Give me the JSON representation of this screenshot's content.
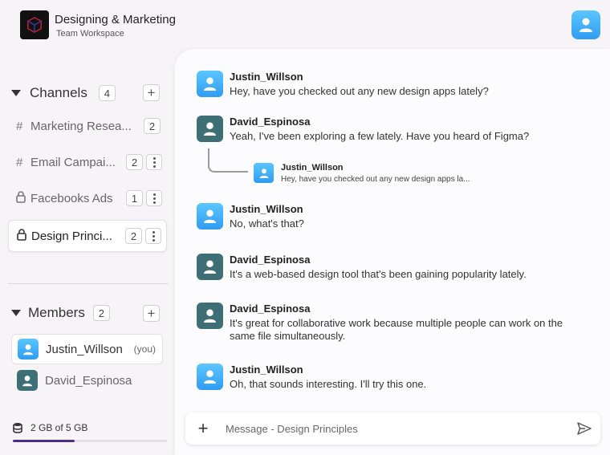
{
  "workspace": {
    "title": "Designing & Marketing",
    "subtitle": "Team Workspace"
  },
  "sidebar": {
    "channels_title": "Channels",
    "channels_count": "4",
    "channels": [
      {
        "prefix": "#",
        "label": "Marketing Resea...",
        "count": "2",
        "locked": false,
        "active": false
      },
      {
        "prefix": "#",
        "label": "Email Campai...",
        "count": "2",
        "locked": false,
        "active": false
      },
      {
        "prefix": "lock",
        "label": "Facebooks Ads",
        "count": "1",
        "locked": true,
        "active": false
      },
      {
        "prefix": "lock",
        "label": "Design Princi...",
        "count": "2",
        "locked": true,
        "active": true
      }
    ],
    "members_title": "Members",
    "members_count": "2",
    "members": [
      {
        "name": "Justin_Willson",
        "suffix": "(you)",
        "avatar": "blue",
        "active": true
      },
      {
        "name": "David_Espinosa",
        "suffix": "",
        "avatar": "teal",
        "active": false
      }
    ],
    "storage": {
      "label": "2 GB of 5 GB",
      "used_fraction": 0.4
    }
  },
  "chat": {
    "messages": [
      {
        "author": "Justin_Willson",
        "text": "Hey, have you checked out any new design apps lately?",
        "avatar": "blue"
      },
      {
        "author": "David_Espinosa",
        "text": "Yeah, I've been exploring a few lately. Have you heard of Figma?",
        "avatar": "teal"
      },
      {
        "author": "Justin_Willson",
        "text": "No, what's that?",
        "avatar": "blue"
      },
      {
        "author": "David_Espinosa",
        "text": "It's a web-based design tool that's been gaining popularity lately.",
        "avatar": "teal"
      },
      {
        "author": "David_Espinosa",
        "text": "It's great for collaborative work because multiple people can work on the same file simultaneously.",
        "avatar": "teal"
      },
      {
        "author": "Justin_Willson",
        "text": "Oh, that sounds interesting. I'll try this one.",
        "avatar": "blue"
      }
    ],
    "reply_preview": {
      "author": "Justin_Willson",
      "text": "Hey, have you checked out any new design apps la..."
    },
    "composer": {
      "placeholder": "Message - Design Principles"
    }
  },
  "colors": {
    "avatar_blue": "#2f9cf3",
    "avatar_teal": "#3e6e76",
    "storage_fill": "#4a2f87"
  },
  "icons": [
    "cube-logo-icon",
    "user-icon",
    "plus-icon",
    "lock-icon",
    "more-vertical-icon",
    "database-icon",
    "send-icon",
    "caret-down-icon"
  ]
}
